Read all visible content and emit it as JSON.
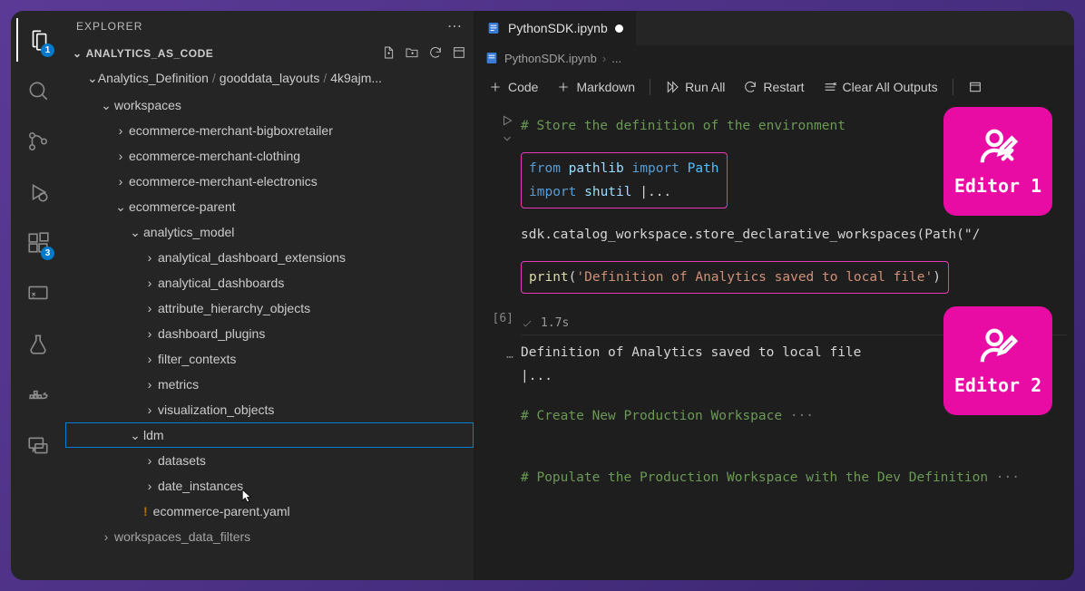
{
  "explorer": {
    "title": "EXPLORER"
  },
  "project": {
    "name": "ANALYTICS_AS_CODE"
  },
  "badges": {
    "explorer": "1",
    "extensions": "3"
  },
  "breadcrumb": {
    "a": "Analytics_Definition",
    "b": "gooddata_layouts",
    "c": "4k9ajm..."
  },
  "tree": {
    "workspaces": "workspaces",
    "bigbox": "ecommerce-merchant-bigboxretailer",
    "clothing": "ecommerce-merchant-clothing",
    "electronics": "ecommerce-merchant-electronics",
    "parent": "ecommerce-parent",
    "am": "analytics_model",
    "ade": "analytical_dashboard_extensions",
    "ad": "analytical_dashboards",
    "aho": "attribute_hierarchy_objects",
    "dp": "dashboard_plugins",
    "fc": "filter_contexts",
    "metrics": "metrics",
    "vo": "visualization_objects",
    "ldm": "ldm",
    "datasets": "datasets",
    "di": "date_instances",
    "yaml": "ecommerce-parent.yaml",
    "wdf": "workspaces_data_filters"
  },
  "tab": {
    "title": "PythonSDK.ipynb"
  },
  "crumbs": {
    "a": "PythonSDK.ipynb",
    "b": "..."
  },
  "toolbar": {
    "code": "Code",
    "markdown": "Markdown",
    "runall": "Run All",
    "restart": "Restart",
    "clear": "Clear All Outputs"
  },
  "code": {
    "c1": "# Store the definition of the environment",
    "l1a": "from",
    "l1b": " pathlib ",
    "l1c": "import",
    "l1d": " Path",
    "l2a": "import",
    "l2b": " shutil ",
    "l2c": "...",
    "l3": "sdk.catalog_workspace.store_declarative_workspaces(Path(\"/",
    "l4a": "print",
    "l4b": "(",
    "l4c": "'Definition of Analytics saved to local file'",
    "l4d": ")",
    "execount": "[6]",
    "time": "1.7s",
    "out": "Definition of Analytics saved to local file",
    "out2": "...",
    "c2": "# Create New Production Workspace",
    "e2": "···",
    "c3": "# Populate the Production Workspace with the Dev Definition",
    "e3": "···"
  },
  "tags": {
    "e1": "Editor 1",
    "e2": "Editor 2"
  }
}
